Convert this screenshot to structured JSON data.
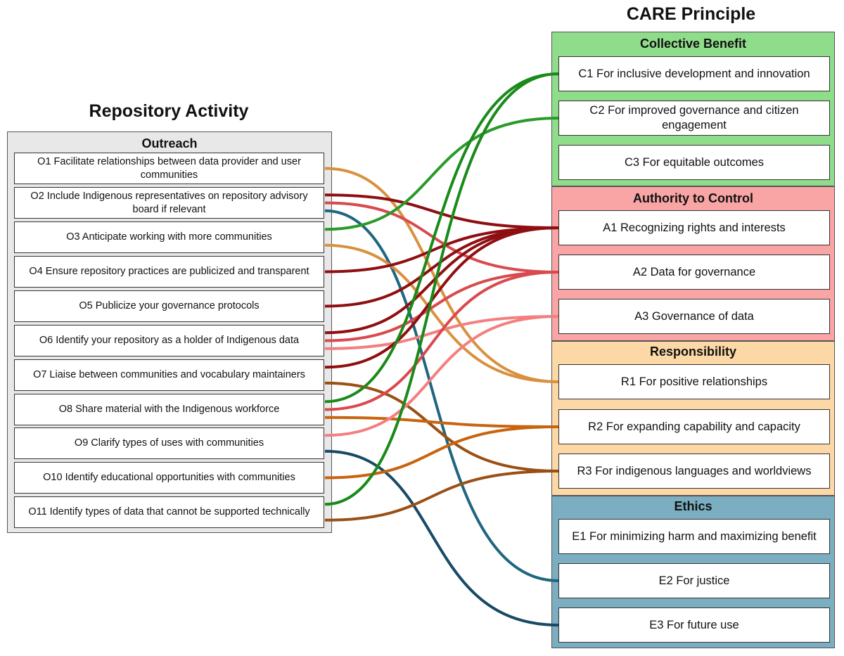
{
  "left_title": "Repository Activity",
  "right_title": "CARE Principle",
  "outreach": {
    "title": "Outreach",
    "items": [
      {
        "id": "O1",
        "label": "O1 Facilitate relationships between data provider and user communities"
      },
      {
        "id": "O2",
        "label": "O2 Include Indigenous representatives on repository advisory board if relevant"
      },
      {
        "id": "O3",
        "label": "O3 Anticipate working with more communities"
      },
      {
        "id": "O4",
        "label": "O4 Ensure repository practices are publicized and transparent"
      },
      {
        "id": "O5",
        "label": "O5 Publicize your governance protocols"
      },
      {
        "id": "O6",
        "label": "O6 Identify your repository as a holder of Indigenous data"
      },
      {
        "id": "O7",
        "label": "O7 Liaise between communities and vocabulary maintainers"
      },
      {
        "id": "O8",
        "label": "O8 Share material with the Indigenous workforce"
      },
      {
        "id": "O9",
        "label": "O9 Clarify types of uses with communities"
      },
      {
        "id": "O10",
        "label": "O10 Identify educational opportunities with communities"
      },
      {
        "id": "O11",
        "label": "O11 Identify types of data that cannot be supported technically"
      }
    ]
  },
  "care": [
    {
      "key": "C",
      "title": "Collective Benefit",
      "color": "#8fdd8b",
      "items": [
        {
          "id": "C1",
          "label": "C1 For inclusive development and innovation"
        },
        {
          "id": "C2",
          "label": "C2 For improved governance and citizen engagement"
        },
        {
          "id": "C3",
          "label": "C3 For equitable outcomes"
        }
      ]
    },
    {
      "key": "A",
      "title": "Authority to Control",
      "color": "#f9a5a5",
      "items": [
        {
          "id": "A1",
          "label": "A1 Recognizing rights and interests"
        },
        {
          "id": "A2",
          "label": "A2 Data for governance"
        },
        {
          "id": "A3",
          "label": "A3 Governance of data"
        }
      ]
    },
    {
      "key": "R",
      "title": "Responsibility",
      "color": "#fdd8a7",
      "items": [
        {
          "id": "R1",
          "label": "R1 For positive relationships"
        },
        {
          "id": "R2",
          "label": "R2 For expanding capability and capacity"
        },
        {
          "id": "R3",
          "label": "R3 For indigenous languages and worldviews"
        }
      ]
    },
    {
      "key": "E",
      "title": "Ethics",
      "color": "#7aaec0",
      "items": [
        {
          "id": "E1",
          "label": "E1 For minimizing harm and maximizing benefit"
        },
        {
          "id": "E2",
          "label": "E2 For justice"
        },
        {
          "id": "E3",
          "label": "E3 For future use"
        }
      ]
    }
  ],
  "link_colors": {
    "C1": "#1a8a1a",
    "C2": "#2a9a2a",
    "A1": "#8e0f12",
    "A2": "#d94a4e",
    "A3": "#f47f80",
    "R1": "#d9913f",
    "R2": "#c8640f",
    "R3": "#9a5014",
    "E2": "#1f6680",
    "E3": "#184a66"
  },
  "links": [
    {
      "from": "O1",
      "to": "R1"
    },
    {
      "from": "O2",
      "to": "A1"
    },
    {
      "from": "O2",
      "to": "A2"
    },
    {
      "from": "O2",
      "to": "E2"
    },
    {
      "from": "O3",
      "to": "C2"
    },
    {
      "from": "O3",
      "to": "R1"
    },
    {
      "from": "O4",
      "to": "A1"
    },
    {
      "from": "O5",
      "to": "A1"
    },
    {
      "from": "O6",
      "to": "A1"
    },
    {
      "from": "O6",
      "to": "A2"
    },
    {
      "from": "O6",
      "to": "A3"
    },
    {
      "from": "O7",
      "to": "A1"
    },
    {
      "from": "O7",
      "to": "R3"
    },
    {
      "from": "O8",
      "to": "C1"
    },
    {
      "from": "O8",
      "to": "A2"
    },
    {
      "from": "O8",
      "to": "R2"
    },
    {
      "from": "O9",
      "to": "A3"
    },
    {
      "from": "O9",
      "to": "E3"
    },
    {
      "from": "O10",
      "to": "R2"
    },
    {
      "from": "O11",
      "to": "C1"
    },
    {
      "from": "O11",
      "to": "R3"
    }
  ]
}
